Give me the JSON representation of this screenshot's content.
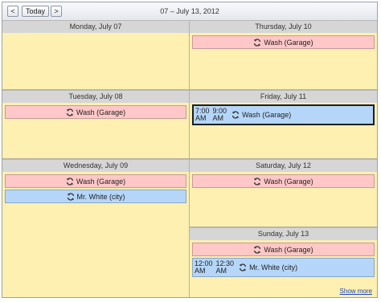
{
  "toolbar": {
    "prev_label": "<",
    "today_label": "Today",
    "next_label": ">",
    "range_title": "07 – July 13, 2012"
  },
  "days": {
    "mon": {
      "header": "Monday, July 07"
    },
    "tue": {
      "header": "Tuesday, July 08",
      "appointments": [
        {
          "subject": "Wash (Garage)",
          "color": "pink",
          "recurring": true
        }
      ]
    },
    "wed": {
      "header": "Wednesday, July 09",
      "appointments": [
        {
          "subject": "Wash (Garage)",
          "color": "pink",
          "recurring": true
        },
        {
          "subject": "Mr. White (city)",
          "color": "blue",
          "recurring": true
        }
      ]
    },
    "thu": {
      "header": "Thursday, July 10",
      "appointments": [
        {
          "subject": "Wash (Garage)",
          "color": "pink",
          "recurring": true
        }
      ]
    },
    "fri": {
      "header": "Friday, July 11",
      "appointments": [
        {
          "start_time": "7:00",
          "start_ampm": "AM",
          "end_time": "9:00",
          "end_ampm": "AM",
          "subject": "Wash (Garage)",
          "color": "blue",
          "recurring": true,
          "selected": true
        }
      ]
    },
    "sat": {
      "header": "Saturday, July 12",
      "appointments": [
        {
          "subject": "Wash (Garage)",
          "color": "pink",
          "recurring": true
        }
      ]
    },
    "sun": {
      "header": "Sunday, July 13",
      "appointments": [
        {
          "subject": "Wash (Garage)",
          "color": "pink",
          "recurring": true
        },
        {
          "start_time": "12:00",
          "start_ampm": "AM",
          "end_time": "12:30",
          "end_ampm": "AM",
          "subject": "Mr. White (city)",
          "color": "blue",
          "recurring": true
        }
      ]
    }
  },
  "show_more_label": "Show more",
  "colors": {
    "day_background": "#fdf0b0",
    "appointment_pink": "#ffc7c7",
    "appointment_blue": "#b5d6f8",
    "header_gray": "#d6d6d6",
    "link_blue": "#1b46c9"
  },
  "icons": {
    "recurrence": "recurrence-icon"
  }
}
